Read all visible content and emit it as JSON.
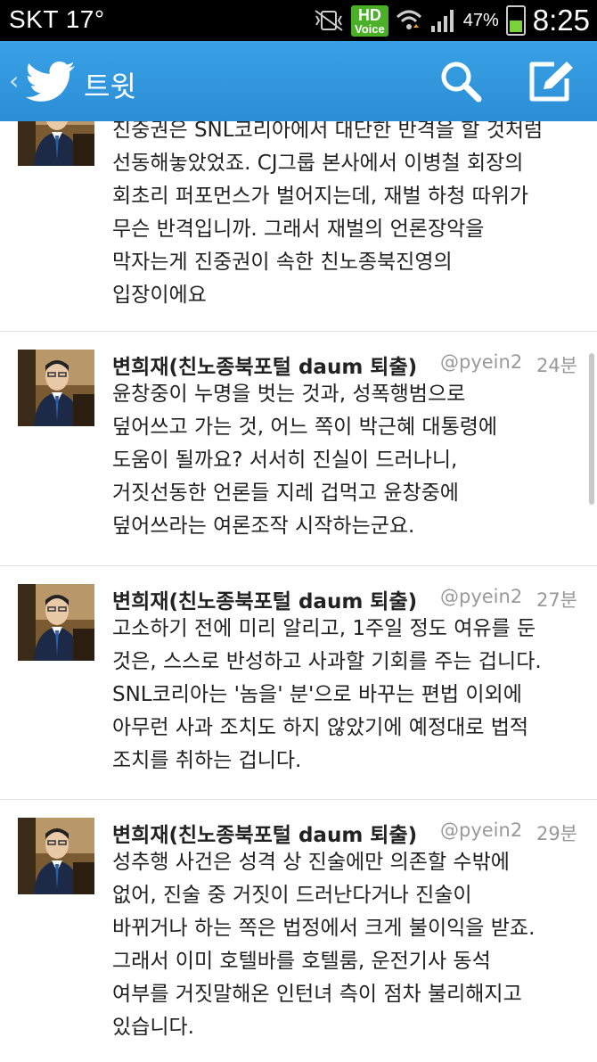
{
  "status_bar": {
    "carrier_temp": "SKT 17°",
    "hd_label": "HD",
    "voice_label": "Voice",
    "battery": "47%",
    "time": "8:25"
  },
  "action_bar": {
    "title": "트윗",
    "icons": [
      "chevron-left-icon",
      "twitter-bird-icon",
      "search-icon",
      "compose-icon"
    ],
    "bar_color": "#2b93dc"
  },
  "tweets": [
    {
      "lines": [
        "진중권은 SNL코리아에서 대단한 반격을 할 것처럼",
        "선동해놓았었죠. CJ그룹 본사에서 이병철 회장의",
        "회초리 퍼포먼스가 벌어지는데, 재벌 하청 따위가",
        "무슨 반격입니까. 그래서 재벌의 언론장악을",
        "막자는게 진중권이 속한 친노종북진영의",
        "입장이에요"
      ]
    },
    {
      "name": "변희재(친노종북포털 daum 퇴출)",
      "handle": "@pyein2",
      "time": "24분",
      "lines": [
        "윤창중이 누명을 벗는 것과, 성폭행범으로",
        "덮어쓰고 가는 것, 어느 쪽이 박근혜 대통령에",
        "도움이 될까요? 서서히 진실이 드러나니,",
        "거짓선동한 언론들 지레 겁먹고 윤창중에",
        "덮어쓰라는 여론조작 시작하는군요."
      ]
    },
    {
      "name": "변희재(친노종북포털 daum 퇴출)",
      "handle": "@pyein2",
      "time": "27분",
      "lines": [
        "고소하기 전에 미리 알리고, 1주일 정도 여유를 둔",
        "것은, 스스로 반성하고 사과할 기회를 주는 겁니다.",
        "SNL코리아는 '놈을' 분'으로 바꾸는 편법 이외에",
        "아무런 사과 조치도 하지 않았기에 예정대로 법적",
        "조치를 취하는 겁니다."
      ]
    },
    {
      "name": "변희재(친노종북포털 daum 퇴출)",
      "handle": "@pyein2",
      "time": "29분",
      "lines": [
        "성추행 사건은 성격 상 진술에만 의존할 수밖에",
        "없어, 진술 중 거짓이 드러난다거나 진술이",
        "바뀌거나 하는 쪽은 법정에서 크게 불이익을 받죠.",
        "그래서 이미 호텔바를 호텔룸, 운전기사 동석",
        "여부를 거짓말해온 인턴녀 측이 점차 불리해지고",
        "있습니다."
      ]
    }
  ]
}
